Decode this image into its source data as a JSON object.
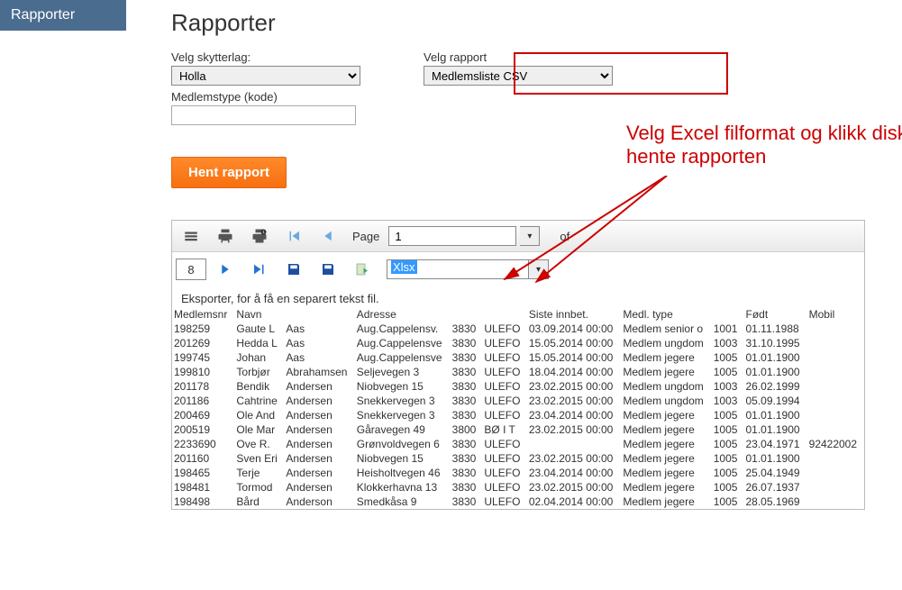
{
  "sidebar": {
    "title": "Rapporter"
  },
  "page": {
    "title": "Rapporter"
  },
  "form": {
    "skytterlag_label": "Velg skytterlag:",
    "skytterlag_value": "Holla",
    "rapport_label": "Velg rapport",
    "rapport_value": "Medlemsliste CSV",
    "medlemstype_label": "Medlemstype (kode)",
    "medlemstype_value": ""
  },
  "annotation": "Velg Excel filformat og klikk diskettenfor å hente rapporten",
  "button": {
    "hent": "Hent rapport"
  },
  "toolbar": {
    "page_label": "Page",
    "page_value": "1",
    "of_label": "of",
    "count": "8",
    "format_value": "Xlsx"
  },
  "hint": "Eksporter, for å få en separert tekst fil.",
  "columns": [
    "Medlemsnr",
    "Navn",
    "",
    "Adresse",
    "",
    "",
    "Siste innbet.",
    "Medl. type",
    "",
    "Født",
    "Mobil"
  ],
  "rows": [
    [
      "198259",
      "Gaute L",
      "Aas",
      "Aug.Cappelensv.",
      "3830",
      "ULEFO",
      "03.09.2014 00:00",
      "Medlem senior o",
      "1001",
      "01.11.1988",
      ""
    ],
    [
      "201269",
      "Hedda L",
      "Aas",
      "Aug.Cappelensve",
      "3830",
      "ULEFO",
      "15.05.2014 00:00",
      "Medlem ungdom",
      "1003",
      "31.10.1995",
      ""
    ],
    [
      "199745",
      "Johan",
      "Aas",
      "Aug.Cappelensve",
      "3830",
      "ULEFO",
      "15.05.2014 00:00",
      "Medlem jegere",
      "1005",
      "01.01.1900",
      ""
    ],
    [
      "199810",
      "Torbjør",
      "Abrahamsen",
      "Seljevegen 3",
      "3830",
      "ULEFO",
      "18.04.2014 00:00",
      "Medlem jegere",
      "1005",
      "01.01.1900",
      ""
    ],
    [
      "201178",
      "Bendik",
      "Andersen",
      "Niobvegen 15",
      "3830",
      "ULEFO",
      "23.02.2015 00:00",
      "Medlem ungdom",
      "1003",
      "26.02.1999",
      ""
    ],
    [
      "201186",
      "Cahtrine",
      "Andersen",
      "Snekkervegen 3",
      "3830",
      "ULEFO",
      "23.02.2015 00:00",
      "Medlem ungdom",
      "1003",
      "05.09.1994",
      ""
    ],
    [
      "200469",
      "Ole And",
      "Andersen",
      "Snekkervegen 3",
      "3830",
      "ULEFO",
      "23.04.2014 00:00",
      "Medlem jegere",
      "1005",
      "01.01.1900",
      ""
    ],
    [
      "200519",
      "Ole Mar",
      "Andersen",
      "Gåravegen 49",
      "3800",
      "BØ I T",
      "23.02.2015 00:00",
      "Medlem jegere",
      "1005",
      "01.01.1900",
      ""
    ],
    [
      "2233690",
      "Ove R.",
      "Andersen",
      "Grønvoldvegen 6",
      "3830",
      "ULEFO",
      "",
      "Medlem jegere",
      "1005",
      "23.04.1971",
      "92422002"
    ],
    [
      "201160",
      "Sven Eri",
      "Andersen",
      "Niobvegen 15",
      "3830",
      "ULEFO",
      "23.02.2015 00:00",
      "Medlem jegere",
      "1005",
      "01.01.1900",
      ""
    ],
    [
      "198465",
      "Terje",
      "Andersen",
      "Heisholtvegen 46",
      "3830",
      "ULEFO",
      "23.04.2014 00:00",
      "Medlem jegere",
      "1005",
      "25.04.1949",
      ""
    ],
    [
      "198481",
      "Tormod",
      "Andersen",
      "Klokkerhavna 13",
      "3830",
      "ULEFO",
      "23.02.2015 00:00",
      "Medlem jegere",
      "1005",
      "26.07.1937",
      ""
    ],
    [
      "198498",
      "Bård",
      "Anderson",
      "Smedkåsa 9",
      "3830",
      "ULEFO",
      "02.04.2014 00:00",
      "Medlem jegere",
      "1005",
      "28.05.1969",
      ""
    ]
  ]
}
